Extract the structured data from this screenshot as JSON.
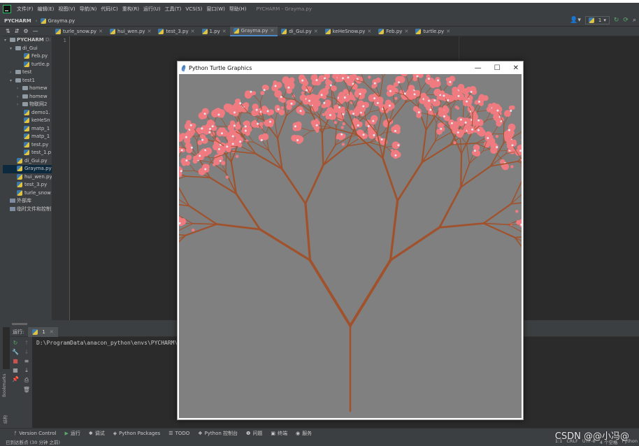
{
  "menubar": {
    "items": [
      "文件(F)",
      "编辑(E)",
      "视图(V)",
      "导航(N)",
      "代码(C)",
      "重构(R)",
      "运行(U)",
      "工具(T)",
      "VCS(S)",
      "窗口(W)",
      "帮助(H)"
    ],
    "window_title": "PYCHARM - Grayma.py"
  },
  "navbar": {
    "root": "PYCHARM",
    "file": "Grayma.py",
    "run_config": "1"
  },
  "project": {
    "root_label": "PYCHARM",
    "root_suffix": "D:",
    "tree": [
      "di_Gui",
      "Feb.py",
      "turtle.p",
      "test",
      "test1",
      "homew",
      "homew",
      "物联网2",
      "demo1.",
      "keHeSn",
      "matp_1",
      "matp_1",
      "test.py",
      "test_1.p",
      "di_Gui.py",
      "Grayma.py",
      "hui_wen.py",
      "test_3.py",
      "turle_snow",
      "外部库",
      "临时文件和控制"
    ]
  },
  "tabs": [
    "turle_snow.py",
    "hui_wen.py",
    "test_3.py",
    "1.py",
    "Grayma.py",
    "di_Gui.py",
    "keHeSnow.py",
    "Feb.py",
    "turtle.py"
  ],
  "editor": {
    "line_number": "1"
  },
  "run_panel": {
    "label": "运行:",
    "tab": "1",
    "output": "D:\\ProgramData\\anacon_python\\envs\\PYCHARM\\py"
  },
  "bookmarks_label": "Bookmarks",
  "structure_label": "结构",
  "bottom_tools": [
    "Version Control",
    "运行",
    "调试",
    "Python Packages",
    "TODO",
    "Python 控制台",
    "问题",
    "终端",
    "服务"
  ],
  "statusbar": {
    "left": "已到达断点 (30 分钟 之前)",
    "right": [
      "1:1",
      "CRLF",
      "UTF-8",
      "4 个空格",
      "Python"
    ]
  },
  "turtle_window": {
    "title": "Python Turtle Graphics",
    "canvas_bg": "#808080",
    "branch_color": "#a0522d",
    "blossom_color": "#ef7b80"
  },
  "watermark": "CSDN @@小冯@"
}
